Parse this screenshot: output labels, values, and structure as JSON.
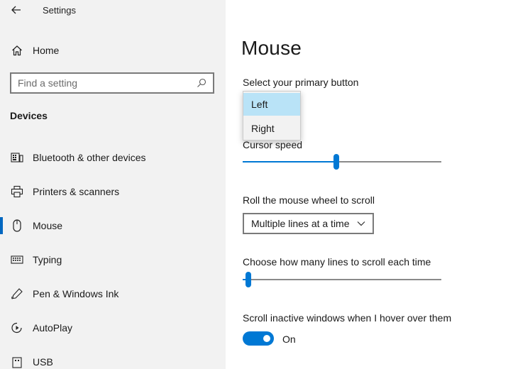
{
  "window": {
    "title": "Settings"
  },
  "sidebar": {
    "home_label": "Home",
    "search_placeholder": "Find a setting",
    "section_title": "Devices",
    "items": [
      {
        "label": "Bluetooth & other devices",
        "icon": "bluetooth-keyboard-icon",
        "selected": false
      },
      {
        "label": "Printers & scanners",
        "icon": "printer-icon",
        "selected": false
      },
      {
        "label": "Mouse",
        "icon": "mouse-icon",
        "selected": true
      },
      {
        "label": "Typing",
        "icon": "keyboard-icon",
        "selected": false
      },
      {
        "label": "Pen & Windows Ink",
        "icon": "pen-icon",
        "selected": false
      },
      {
        "label": "AutoPlay",
        "icon": "autoplay-icon",
        "selected": false
      },
      {
        "label": "USB",
        "icon": "usb-icon",
        "selected": false
      }
    ]
  },
  "main": {
    "title": "Mouse",
    "primary_button": {
      "label": "Select your primary button",
      "options": [
        "Left",
        "Right"
      ],
      "highlighted": "Left"
    },
    "cursor_speed": {
      "label": "Cursor speed",
      "value_fraction": 0.47
    },
    "scroll_mode": {
      "label": "Roll the mouse wheel to scroll",
      "value": "Multiple lines at a time"
    },
    "scroll_lines": {
      "label": "Choose how many lines to scroll each time",
      "value_fraction": 0.03
    },
    "inactive_scroll": {
      "label": "Scroll inactive windows when I hover over them",
      "state_label": "On",
      "enabled": true
    }
  },
  "colors": {
    "accent": "#0078d4",
    "sidebar_bg": "#f2f2f2",
    "selection_bar": "#0067c0",
    "highlight": "#b9e3f7"
  }
}
